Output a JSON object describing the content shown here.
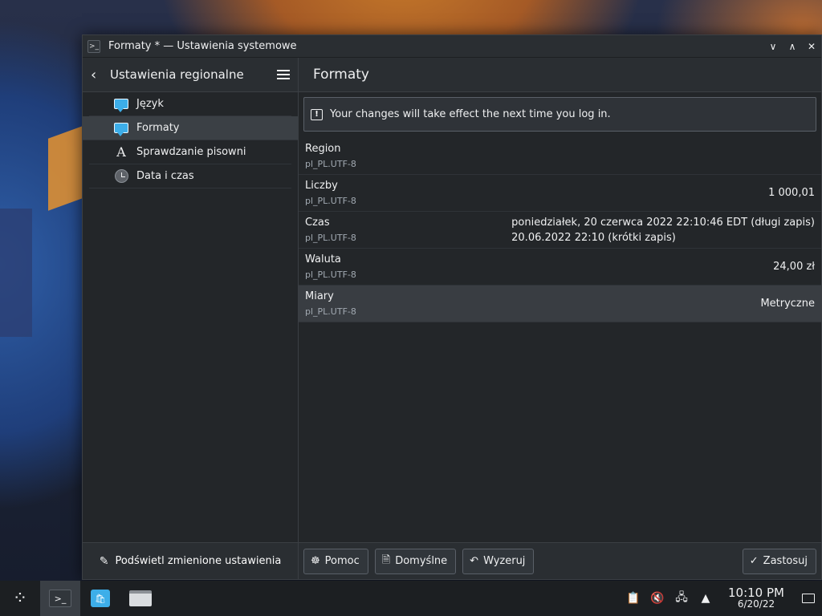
{
  "window": {
    "title": "Formaty * — Ustawienia systemowe"
  },
  "sidebar": {
    "title": "Ustawienia regionalne",
    "items": [
      {
        "label": "Język",
        "icon": "chat-bubble-icon"
      },
      {
        "label": "Formaty",
        "icon": "chat-bubble-icon",
        "active": true
      },
      {
        "label": "Sprawdzanie pisowni",
        "icon": "letter-a-icon"
      },
      {
        "label": "Data i czas",
        "icon": "clock-icon"
      }
    ],
    "footer_label": "Podświetl zmienione ustawienia"
  },
  "main": {
    "title": "Formaty",
    "info": "Your changes will take effect the next time you log in.",
    "rows": [
      {
        "label": "Region",
        "sub": "pl_PL.UTF-8",
        "value": "",
        "value2": ""
      },
      {
        "label": "Liczby",
        "sub": "pl_PL.UTF-8",
        "value": "1 000,01",
        "value2": ""
      },
      {
        "label": "Czas",
        "sub": "pl_PL.UTF-8",
        "value": "poniedziałek, 20 czerwca 2022 22:10:46 EDT (długi zapis)",
        "value2": "20.06.2022 22:10 (krótki zapis)"
      },
      {
        "label": "Waluta",
        "sub": "pl_PL.UTF-8",
        "value": "24,00 zł",
        "value2": ""
      },
      {
        "label": "Miary",
        "sub": "pl_PL.UTF-8",
        "value": "Metryczne",
        "value2": ""
      }
    ],
    "buttons": {
      "help": "Pomoc",
      "defaults": "Domyślne",
      "reset": "Wyzeruj",
      "apply": "Zastosuj"
    }
  },
  "taskbar": {
    "time": "10:10 PM",
    "date": "6/20/22"
  },
  "colors": {
    "accent": "#3daee9",
    "window_bg": "#232629"
  }
}
